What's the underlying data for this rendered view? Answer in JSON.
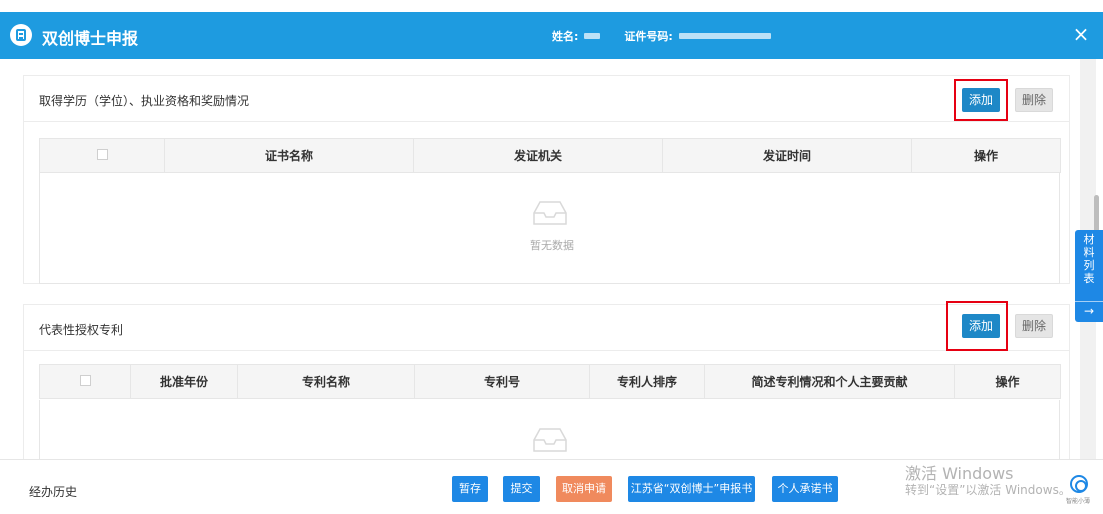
{
  "header": {
    "title": "双创博士申报",
    "name_label": "姓名:",
    "id_label": "证件号码:",
    "close": "×"
  },
  "section1": {
    "title": "取得学历（学位）、执业资格和奖励情况",
    "add_label": "添加",
    "delete_label": "删除",
    "columns": [
      "证书名称",
      "发证机关",
      "发证时间",
      "操作"
    ],
    "empty_text": "暂无数据"
  },
  "section2": {
    "title": "代表性授权专利",
    "add_label": "添加",
    "delete_label": "删除",
    "columns": [
      "批准年份",
      "专利名称",
      "专利号",
      "专利人排序",
      "简述专利情况和个人主要贡献",
      "操作"
    ]
  },
  "side_tab": {
    "label_chars": [
      "材",
      "料",
      "列",
      "表"
    ],
    "arrow": "→"
  },
  "footer": {
    "history": "经办历史",
    "buttons": {
      "save": "暂存",
      "submit": "提交",
      "cancel": "取消申请",
      "application": "江苏省“双创博士”申报书",
      "commitment": "个人承诺书"
    },
    "watermark_line1": "激活 Windows",
    "watermark_line2": "转到“设置”以激活 Windows。",
    "assistant_label": "智能小薄"
  },
  "colors": {
    "header_blue": "#1e9be0",
    "button_blue": "#1e88e5",
    "button_orange": "#f08a5d",
    "highlight_red": "#e60012"
  }
}
